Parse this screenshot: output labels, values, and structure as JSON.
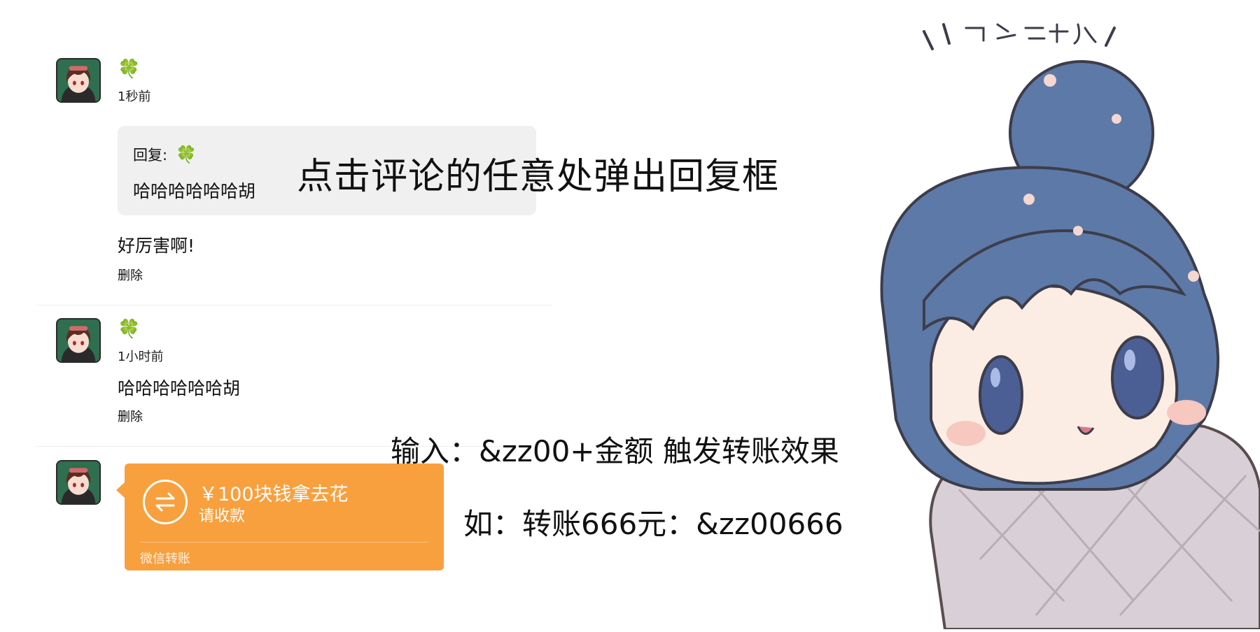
{
  "comments": [
    {
      "time": "1秒前",
      "reply_label": "回复:",
      "reply_quote": "哈哈哈哈哈哈胡",
      "text": "好厉害啊!",
      "delete_label": "删除"
    },
    {
      "time": "1小时前",
      "text": "哈哈哈哈哈哈胡",
      "delete_label": "删除"
    }
  ],
  "transfer": {
    "amount": "￥100块钱拿去花",
    "status": "请收款",
    "footer": "微信转账",
    "color": "#f8a03e"
  },
  "annotations": {
    "reply_hint": "点击评论的任意处弹出回复框",
    "transfer_hint": "输入：&zz00+金额 触发转账效果",
    "example": "如：转账666元：&zz00666"
  },
  "icons": {
    "nickname": "four-leaf-clover-icon",
    "transfer": "transfer-arrows-icon"
  }
}
